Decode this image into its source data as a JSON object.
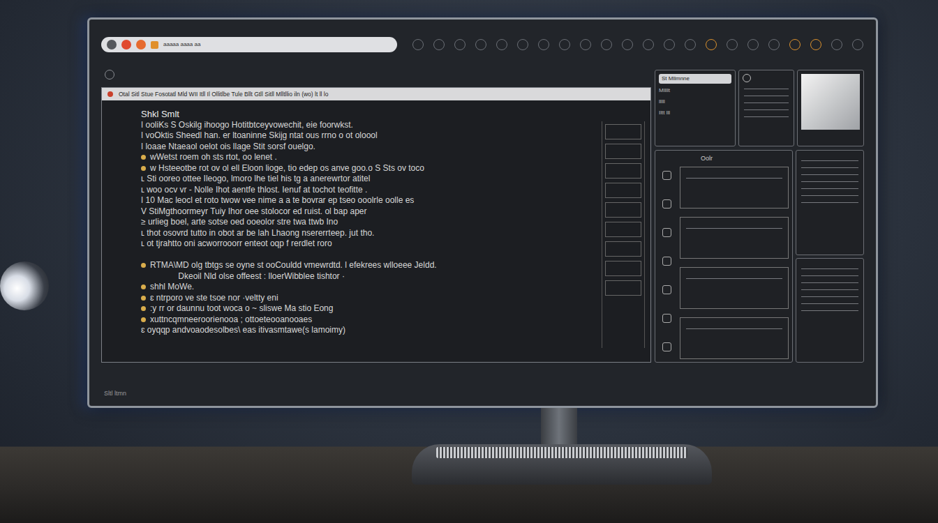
{
  "browser": {
    "address": "aaaaa aaaa aa"
  },
  "window": {
    "tab_text": "Otal Sitl Stue Fosotatl Mld WII Itll Il Ollitlbe Tule Bllt Gtll Sitll Mlltllio iln (wo) lt ll lo",
    "heading": "Shkl Smlt",
    "lines": [
      {
        "text": "ǀ ooliKs S Oskilg ihoogo Hotitbtceyvowechit, eie foorwkst.",
        "kind": "text"
      },
      {
        "text": "ǀ voOktis Sheedl han. er ltoaninne Skijg ntat ous rrno o ot oloool",
        "kind": "text"
      },
      {
        "text": "ǀ loaae Ntaeaol oelot ois llage Stit sorsf ouelgo.",
        "kind": "text"
      },
      {
        "text": "wWetst roem oh sts rtot, oo lenet .",
        "kind": "bullet"
      },
      {
        "text": "w Hsteeotbe rot ov ol ell Eloon lioge, tio edep os anve goo.o S Sts ov toco",
        "kind": "bullet"
      },
      {
        "text": "ʟ Sti ooreo ottee Ileogo, lmoro lhe tiel his tg a anerewrtor atitel",
        "kind": "text"
      },
      {
        "text": "ʟ woo ocv vr - Nolle Ihot aentfe thlost. Ienuf at tochot teofitte .",
        "kind": "text"
      },
      {
        "text": "ǀ 10 Mac leocl et roto twow vee nime a a te bovrar ep tseo ooolrle oolle es",
        "kind": "text"
      },
      {
        "text": "V StiMgthoormeyr Tuiy Ihor oee stolocor ed ruist. ol bap aper",
        "kind": "text"
      },
      {
        "text": "≥ urlieg boel, arte sotse oed ooeolor stre twa ttwb Ino",
        "kind": "text"
      },
      {
        "text": "ʟ thot osovrd tutto in obot ar be lah Lhaong nsererrteep. jut tho.",
        "kind": "text"
      },
      {
        "text": "ʟ ot tjrahtto oni acworrooorr enteot oqp f rerdlet roro",
        "kind": "text"
      },
      {
        "text": "",
        "kind": "text"
      },
      {
        "text": "RTMA\\MD olg tbtgs se oyne st ooCouldd vmewrdtd. l efekrees wlloeee Jeldd.",
        "kind": "bullet"
      },
      {
        "text": "                Dkeoil Nld olse offeest : lloerWibblee tishtor ·",
        "kind": "text"
      },
      {
        "text": "shhl MoWe.",
        "kind": "bullet"
      },
      {
        "text": "ɛ ntrporo ve ste tsoe nor ·veltty eni",
        "kind": "bullet"
      },
      {
        "text": ":y rr or daunnu toot woca o ~ sliswe Ma stio Eong",
        "kind": "bullet"
      },
      {
        "text": "xuttncqmneeroorienooa ; ottoeteooanooaes",
        "kind": "bullet"
      },
      {
        "text": "ɛ oyqqp andvoaodesolbes\\ eas itivasmtawe(s lamoimy)",
        "kind": "text"
      }
    ]
  },
  "side_panels": {
    "title": "St Mllmnne",
    "lines": [
      "Mllllt",
      "lllll",
      "Iltt lll"
    ],
    "lower_title": "Oolr"
  },
  "monitor_label": "Sltl ltmn"
}
